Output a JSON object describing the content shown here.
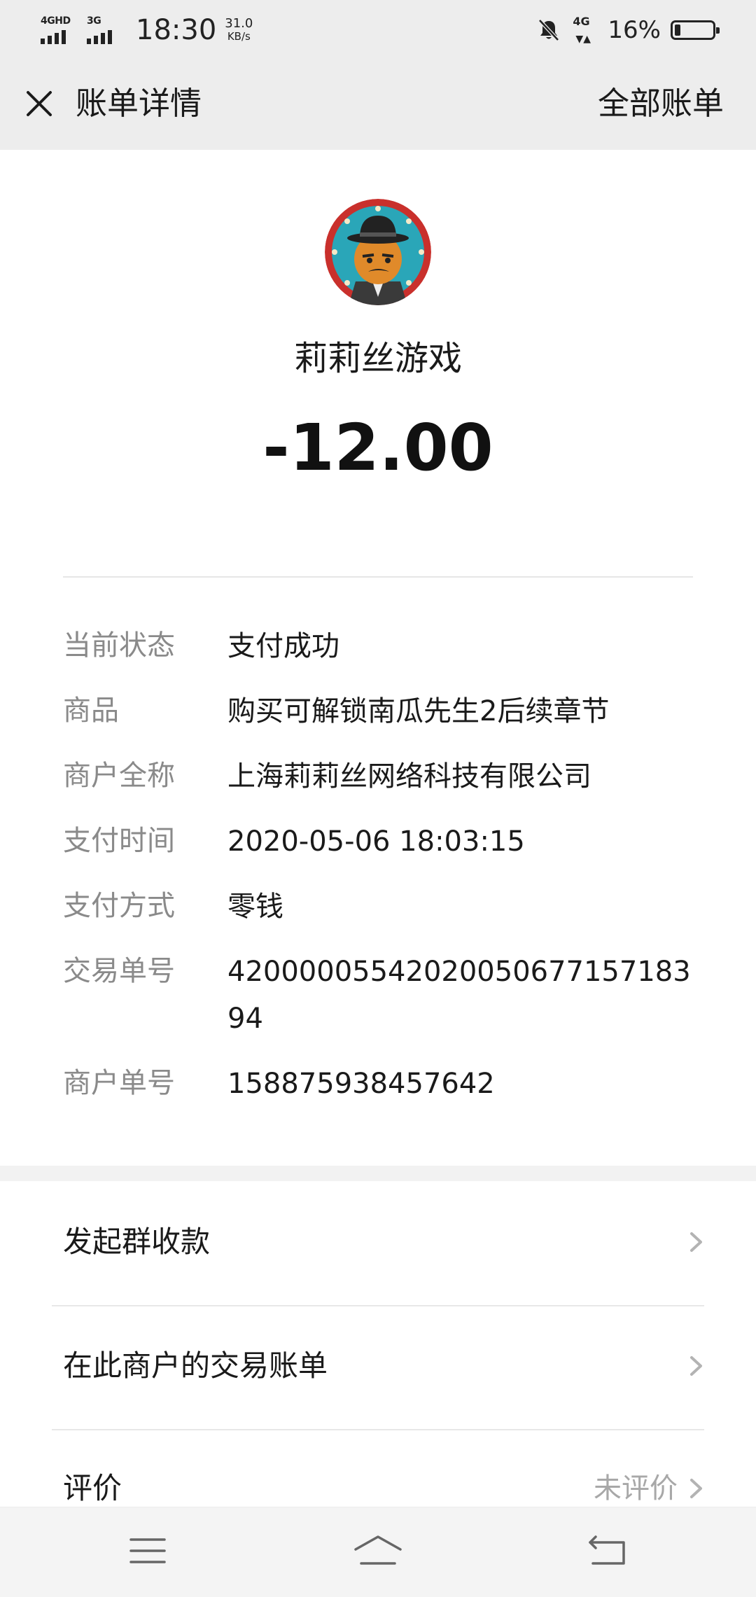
{
  "status_bar": {
    "network1": "4GHD",
    "network2": "3G",
    "time": "18:30",
    "speed_value": "31.0",
    "speed_unit": "KB/s",
    "network3": "4G",
    "battery_percent": "16%",
    "battery_level": 0.16
  },
  "nav": {
    "title": "账单详情",
    "action": "全部账单"
  },
  "merchant": {
    "name": "莉莉丝游戏",
    "amount": "-12.00"
  },
  "details": [
    {
      "label": "当前状态",
      "value": "支付成功"
    },
    {
      "label": "商品",
      "value": "购买可解锁南瓜先生2后续章节"
    },
    {
      "label": "商户全称",
      "value": "上海莉莉丝网络科技有限公司"
    },
    {
      "label": "支付时间",
      "value": "2020-05-06 18:03:15"
    },
    {
      "label": "支付方式",
      "value": "零钱"
    },
    {
      "label": "交易单号",
      "value": "4200000554202005067715718394"
    },
    {
      "label": "商户单号",
      "value": "158875938457642"
    }
  ],
  "actions": [
    {
      "label": "发起群收款",
      "status": ""
    },
    {
      "label": "在此商户的交易账单",
      "status": ""
    },
    {
      "label": "评价",
      "status": "未评价"
    }
  ],
  "colors": {
    "header_bg": "#ededed",
    "label_gray": "#8a8a8a",
    "text_dark": "#1a1a1a"
  }
}
